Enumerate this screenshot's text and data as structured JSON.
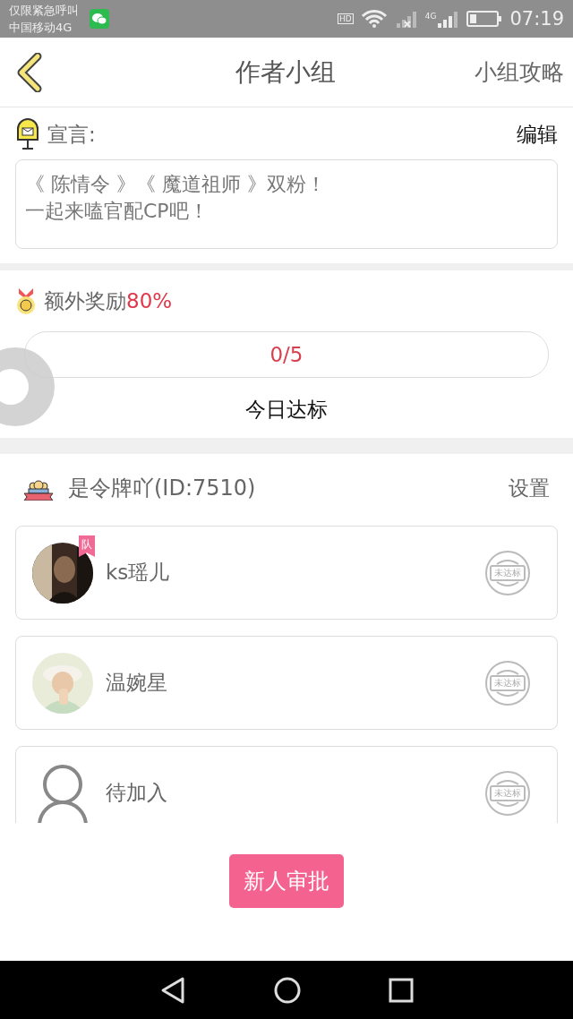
{
  "status_bar": {
    "notice": "仅限紧急呼叫",
    "carrier": "中国移动4G",
    "hd": "HD",
    "network": "4G",
    "time": "07:19"
  },
  "header": {
    "title": "作者小组",
    "action": "小组攻略"
  },
  "slogan": {
    "label": "宣言:",
    "edit": "编辑",
    "lines": [
      "《 陈情令 》《 魔道祖师 》双粉！",
      "一起来嗑官配CP吧！"
    ]
  },
  "reward": {
    "label": "额外奖励",
    "percent": "80%",
    "progress": "0/5",
    "level": 0,
    "caption": "今日达标"
  },
  "team": {
    "name": "是令牌吖(ID:7510)",
    "settings": "设置",
    "members": [
      {
        "kind": "member",
        "name": "ks瑶儿",
        "badge": "队",
        "stamp": "未达标"
      },
      {
        "kind": "member",
        "name": "温婉星",
        "stamp": "未达标"
      },
      {
        "kind": "pending",
        "name": "待加入",
        "stamp": "未达标"
      }
    ]
  },
  "approve_button": "新人审批"
}
